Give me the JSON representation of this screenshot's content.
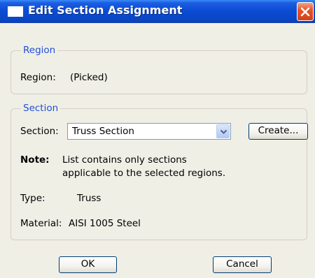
{
  "window": {
    "title": "Edit Section Assignment"
  },
  "region_group": {
    "legend": "Region",
    "label": "Region:",
    "value": "(Picked)"
  },
  "section_group": {
    "legend": "Section",
    "section_label": "Section:",
    "section_value": "Truss Section",
    "create_label": "Create...",
    "note_label": "Note:",
    "note_line1": "List contains only sections",
    "note_line2": "applicable to the selected regions.",
    "type_label": "Type:",
    "type_value": "Truss",
    "material_label": "Material:",
    "material_value": "AISI 1005 Steel"
  },
  "footer": {
    "ok_label": "OK",
    "cancel_label": "Cancel"
  }
}
